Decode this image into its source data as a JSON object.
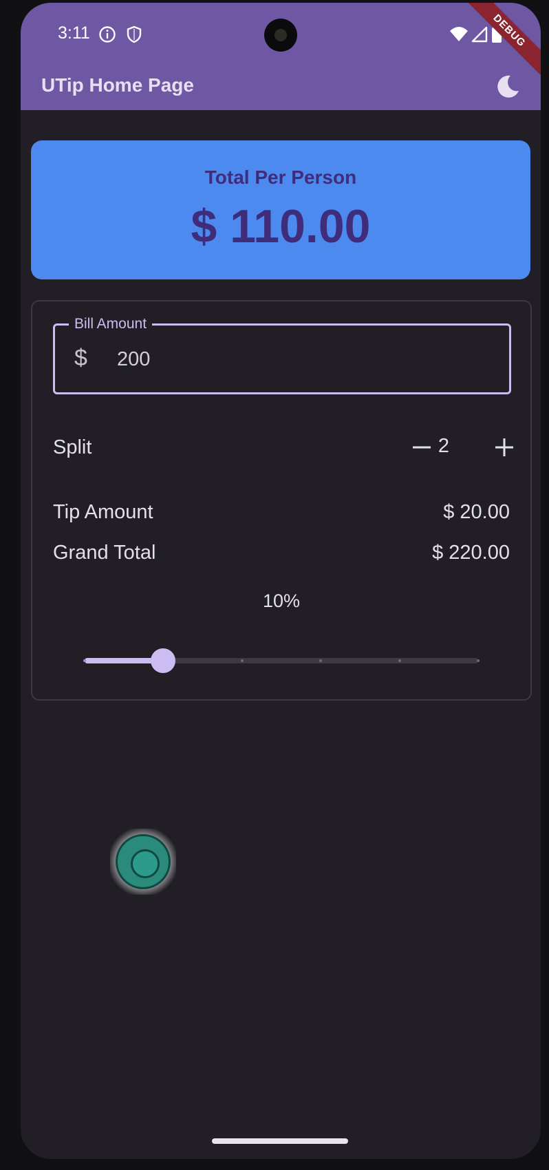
{
  "status_bar": {
    "time": "3:11",
    "icons": [
      "info-icon",
      "shield-icon",
      "wifi-icon",
      "signal-icon",
      "battery-icon"
    ]
  },
  "debug_banner": "DEBUG",
  "app_bar": {
    "title": "UTip Home Page",
    "theme_icon": "moon-icon"
  },
  "summary": {
    "label": "Total Per Person",
    "amount": "$ 110.00"
  },
  "bill": {
    "label": "Bill Amount",
    "prefix": "$",
    "value": "200"
  },
  "split": {
    "label": "Split",
    "value": "2",
    "decrement_icon": "minus-icon",
    "increment_icon": "plus-icon"
  },
  "tip": {
    "label": "Tip Amount",
    "value": "$ 20.00"
  },
  "grand_total": {
    "label": "Grand Total",
    "value": "$ 220.00"
  },
  "tip_slider": {
    "label": "10%",
    "value": 10,
    "min": 0,
    "max": 50,
    "divisions": 5
  },
  "colors": {
    "app_bar": "#6e57a3",
    "summary_card": "#4c8aef",
    "summary_text": "#3f2d7c",
    "accent": "#cbbdf1",
    "background": "#211f25"
  }
}
